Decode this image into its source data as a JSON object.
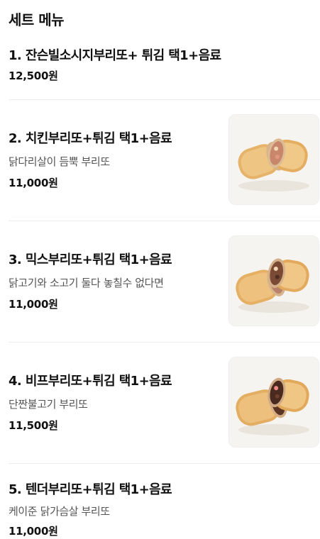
{
  "section": {
    "title": "세트 메뉴"
  },
  "items": [
    {
      "name": "1. 잔슨빌소시지부리또+ 튀김 택1+음료",
      "description": "",
      "price": "12,500원",
      "image": null
    },
    {
      "name": "2. 치킨부리또+튀김 택1+음료",
      "description": "닭다리살이 듬뿍 부리또",
      "price": "11,000원",
      "image": "chicken-burrito-photo"
    },
    {
      "name": "3. 믹스부리또+튀김 택1+음료",
      "description": "닭고기와 소고기 둘다 놓칠수 없다면",
      "price": "11,000원",
      "image": "mix-burrito-photo"
    },
    {
      "name": "4. 비프부리또+튀김 택1+음료",
      "description": "단짠불고기 부리또",
      "price": "11,500원",
      "image": "beef-burrito-photo"
    },
    {
      "name": "5. 텐더부리또+튀김 택1+음료",
      "description": "케이준 닭가슴살 부리또",
      "price": "11,000원",
      "image": null
    }
  ]
}
